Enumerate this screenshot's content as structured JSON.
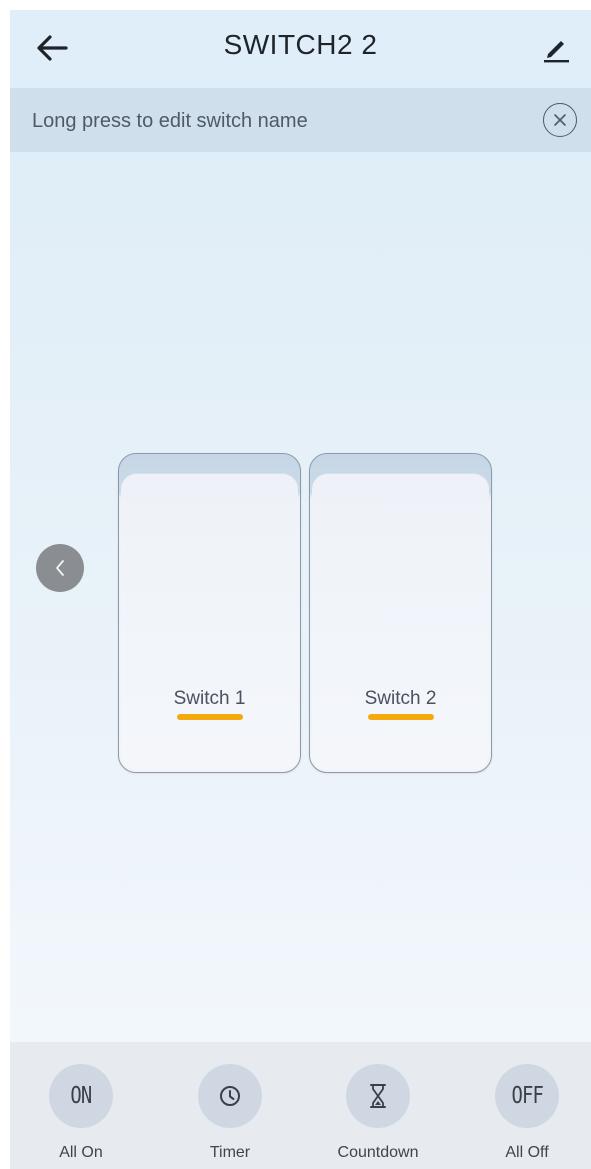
{
  "header": {
    "title": "SWITCH2 2",
    "back_icon": "arrow-left-icon",
    "edit_icon": "pencil-icon"
  },
  "tip": {
    "text": "Long press to edit switch name",
    "close_icon": "close-circle-icon"
  },
  "switches": [
    {
      "label": "Switch 1",
      "indicator_color": "#f4a90c"
    },
    {
      "label": "Switch 2",
      "indicator_color": "#f4a90c"
    }
  ],
  "nav": {
    "prev_icon": "chevron-left-icon"
  },
  "actions": [
    {
      "icon_text": "ON",
      "label": "All On"
    },
    {
      "icon": "clock-icon",
      "label": "Timer"
    },
    {
      "icon": "hourglass-icon",
      "label": "Countdown"
    },
    {
      "icon_text": "OFF",
      "label": "All Off"
    }
  ],
  "colors": {
    "accent_indicator": "#f4a90c",
    "header_bg": "#e0eef9",
    "tip_bg": "#cfdfeb",
    "bottom_bar_bg": "#e7ebef",
    "action_circle_bg": "#cfd8e2"
  }
}
